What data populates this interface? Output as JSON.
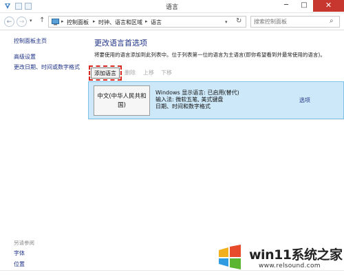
{
  "window": {
    "title": "语言",
    "minimize": "─",
    "maximize": "□",
    "close": "✕"
  },
  "nav": {
    "back": "←",
    "forward": "→",
    "dropdown": "▾",
    "up": "↑",
    "breadcrumbs": [
      "控制面板",
      "时钟、语言和区域",
      "语言"
    ],
    "crumb_sep": "▸",
    "addr_dropdown": "▾",
    "refresh": "↻",
    "search_placeholder": "搜索控制面板",
    "search_icon": "⌕"
  },
  "sidebar": {
    "items": [
      "控制面板主页",
      "高级设置",
      "更改日期、时间或数字格式"
    ],
    "see_also_heading": "另请参阅",
    "see_also": [
      "字体",
      "位置"
    ]
  },
  "main": {
    "title": "更改语言首选项",
    "description": "将要使用的语言添加到此列表中。位于列表第一位的语言为主语言(即你希望看到并最常使用的语言)。",
    "toolbar": {
      "add": "添加语言",
      "remove": "删除",
      "up": "上移",
      "down": "下移"
    },
    "languages": [
      {
        "name": "中文(中华人民共和国)",
        "display_language": "Windows 显示语言: 已启用(替代)",
        "input_methods": "输入法: 微软五笔, 美式键盘",
        "formats": "日期、时间和数字格式",
        "options": "选项"
      }
    ]
  },
  "watermark": {
    "text": "win11系统之家",
    "url": "www.relsound.com"
  },
  "colors": {
    "link": "#1e3287",
    "selected_row": "#cde8f8",
    "highlight": "#d8261c",
    "close": "#c7372f"
  }
}
